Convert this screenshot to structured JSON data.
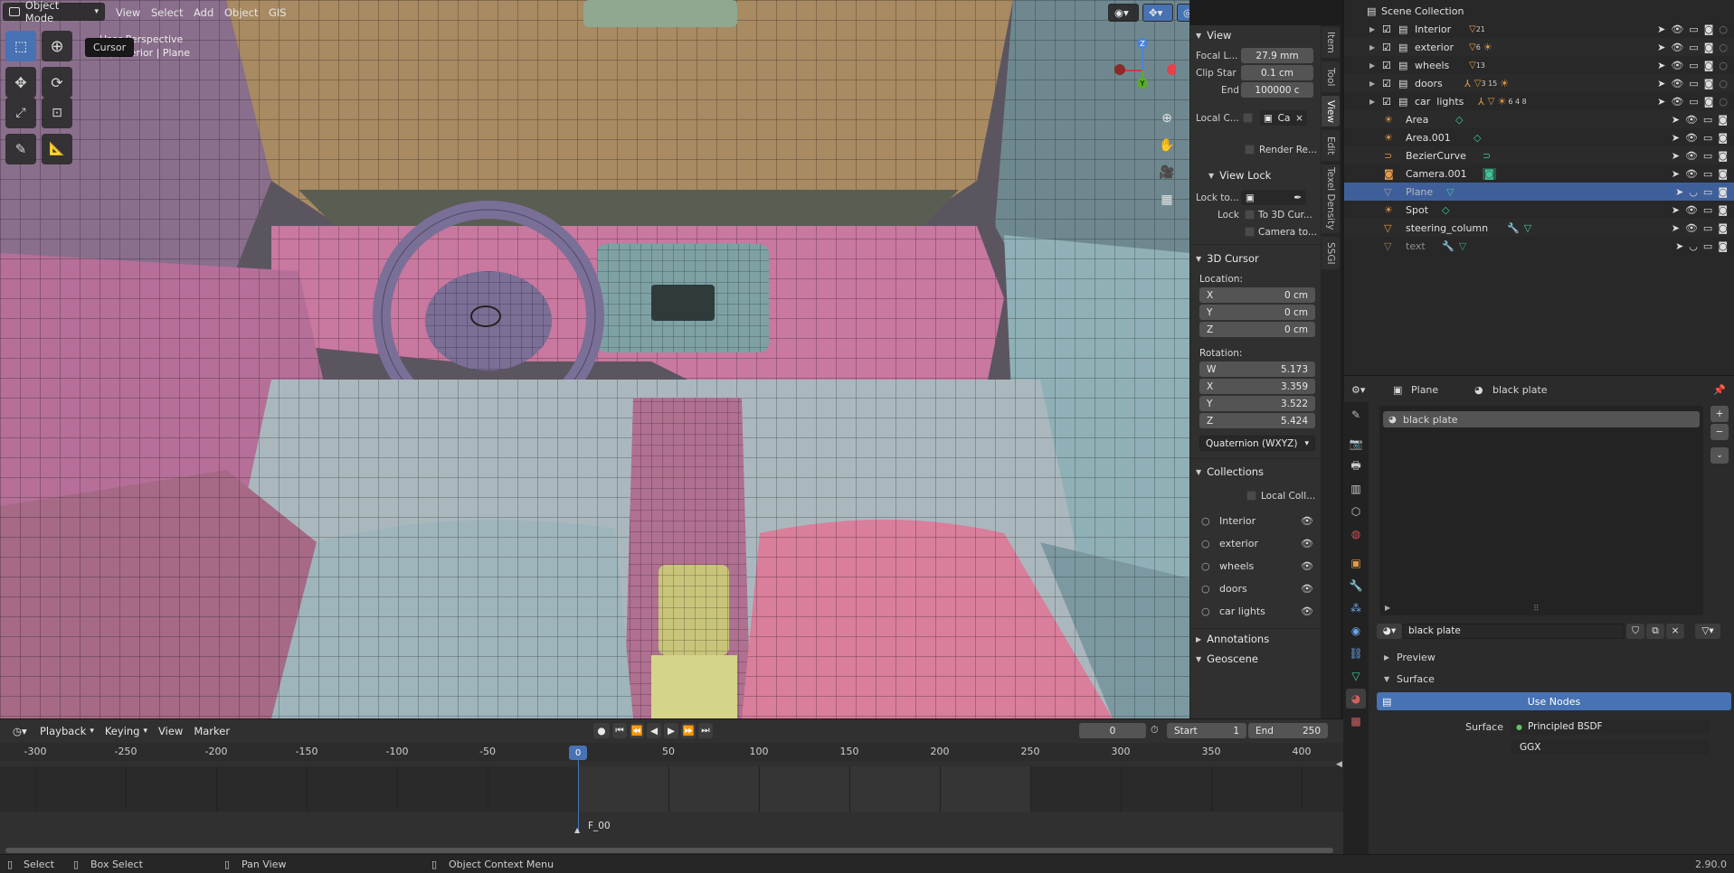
{
  "header": {
    "mode": "Object Mode",
    "menus": [
      "View",
      "Select",
      "Add",
      "Object",
      "GIS"
    ]
  },
  "viewport": {
    "overlay_line1": "User Perspective",
    "overlay_line2": "(0) Interior | Plane",
    "tooltip": "Cursor"
  },
  "npanel": {
    "view_title": "View",
    "focal_label": "Focal L...",
    "focal_value": "27.9 mm",
    "clip_start_label": "Clip Star",
    "clip_start_value": "0.1 cm",
    "end_label": "End",
    "end_value": "100000 c",
    "local_camera_label": "Local C...",
    "local_camera_value": "Ca",
    "render_region": "Render Re...",
    "view_lock_title": "View Lock",
    "lock_to_label": "Lock to...",
    "lock_label": "Lock",
    "to_3d_cursor": "To 3D Cur...",
    "camera_to": "Camera to...",
    "cursor_title": "3D Cursor",
    "location_label": "Location:",
    "loc": [
      {
        "axis": "X",
        "value": "0 cm"
      },
      {
        "axis": "Y",
        "value": "0 cm"
      },
      {
        "axis": "Z",
        "value": "0 cm"
      }
    ],
    "rotation_label": "Rotation:",
    "rot": [
      {
        "axis": "W",
        "value": "5.173"
      },
      {
        "axis": "X",
        "value": "3.359"
      },
      {
        "axis": "Y",
        "value": "3.522"
      },
      {
        "axis": "Z",
        "value": "5.424"
      }
    ],
    "rotation_mode": "Quaternion (WXYZ)",
    "collections_title": "Collections",
    "local_coll": "Local Coll...",
    "collections": [
      "Interior",
      "exterior",
      "wheels",
      "doors",
      "car  lights"
    ],
    "annotations_title": "Annotations",
    "geoscene_title": "Geoscene"
  },
  "ntabs": [
    "Item",
    "Tool",
    "View",
    "Edit",
    "Texel Density",
    "SSGI"
  ],
  "outliner": {
    "root": "Scene Collection",
    "rows": [
      {
        "name": "Interior",
        "badge": "21"
      },
      {
        "name": "exterior",
        "badge": "6"
      },
      {
        "name": "wheels",
        "badge": "13"
      },
      {
        "name": "doors",
        "badge": "3 15"
      },
      {
        "name": "car  lights",
        "badge": "6 4 8"
      },
      {
        "name": "Area",
        "badge": ""
      },
      {
        "name": "Area.001",
        "badge": ""
      },
      {
        "name": "BezierCurve",
        "badge": ""
      },
      {
        "name": "Camera.001",
        "badge": ""
      },
      {
        "name": "Plane",
        "badge": ""
      },
      {
        "name": "Spot",
        "badge": ""
      },
      {
        "name": "steering_column",
        "badge": ""
      },
      {
        "name": "text",
        "badge": ""
      }
    ]
  },
  "properties": {
    "object_name": "Plane",
    "material_name": "black plate",
    "slot_name": "black plate",
    "material_field": "black plate",
    "preview_label": "Preview",
    "surface_label": "Surface",
    "use_nodes": "Use Nodes",
    "surface_field_label": "Surface",
    "surface_value": "Principled BSDF",
    "distribution": "GGX"
  },
  "timeline": {
    "menus": [
      "Playback",
      "Keying",
      "View",
      "Marker"
    ],
    "current_frame": "0",
    "start_label": "Start",
    "start_value": "1",
    "end_label": "End",
    "end_value": "250",
    "ticks": [
      "-300",
      "-250",
      "-200",
      "-150",
      "-100",
      "-50",
      "0",
      "50",
      "100",
      "150",
      "200",
      "250",
      "300",
      "350",
      "400"
    ],
    "marker": "F_00"
  },
  "statusbar": {
    "select": "Select",
    "box_select": "Box Select",
    "pan_view": "Pan View",
    "context_menu": "Object Context Menu",
    "version": "2.90.0"
  }
}
